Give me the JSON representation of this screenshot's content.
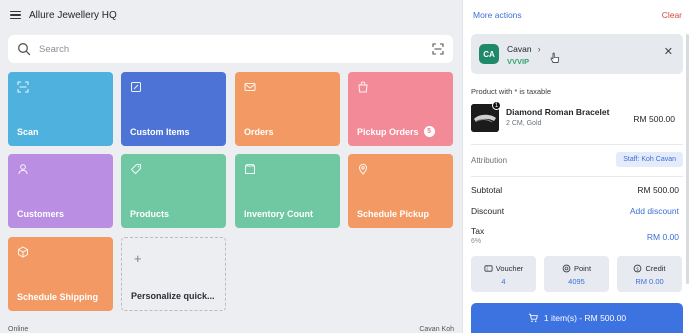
{
  "store": {
    "name": "Allure Jewellery HQ"
  },
  "search": {
    "placeholder": "Search"
  },
  "tiles": [
    {
      "label": "Scan",
      "color": "#4fb1dd",
      "icon": "scan-icon"
    },
    {
      "label": "Custom Items",
      "color": "#4d73d6",
      "icon": "edit-icon"
    },
    {
      "label": "Orders",
      "color": "#f39a64",
      "icon": "mail-icon"
    },
    {
      "label": "Pickup Orders",
      "color": "#f38a98",
      "icon": "bag-icon",
      "badge": "5"
    },
    {
      "label": "Customers",
      "color": "#b98ee3",
      "icon": "person-icon"
    },
    {
      "label": "Products",
      "color": "#6fc8a2",
      "icon": "tag-icon"
    },
    {
      "label": "Inventory Count",
      "color": "#6fc8a2",
      "icon": "box-icon"
    },
    {
      "label": "Schedule Pickup",
      "color": "#f39a64",
      "icon": "location-icon"
    },
    {
      "label": "Schedule Shipping",
      "color": "#f39a64",
      "icon": "cube-icon"
    },
    {
      "label": "Personalize quick...",
      "icon": "plus-icon"
    }
  ],
  "status": {
    "left": "Online",
    "right": "Cavan Koh"
  },
  "cart": {
    "more_actions": "More actions",
    "clear": "Clear",
    "customer": {
      "initials": "CA",
      "name": "Cavan",
      "tier": "VVVIP"
    },
    "tax_note": "Product with * is taxable",
    "item": {
      "qty": "1",
      "name": "Diamond Roman Bracelet",
      "variant": "2 CM, Gold",
      "price": "RM 500.00"
    },
    "attribution_label": "Attribution",
    "staff": "Staff: Koh Cavan",
    "subtotal_label": "Subtotal",
    "subtotal": "RM 500.00",
    "discount_label": "Discount",
    "discount_action": "Add discount",
    "tax_label": "Tax",
    "tax_rate": "6%",
    "tax": "RM 0.00",
    "voucher_label": "Voucher",
    "voucher_value": "4",
    "point_label": "Point",
    "point_value": "4095",
    "credit_label": "Credit",
    "credit_value": "RM 0.00",
    "checkout": "1 item(s) - RM 500.00"
  },
  "colors": {
    "accent": "#3d73e0",
    "link": "#3d6fd6",
    "danger": "#d9463d",
    "tier": "#2fa56b"
  }
}
